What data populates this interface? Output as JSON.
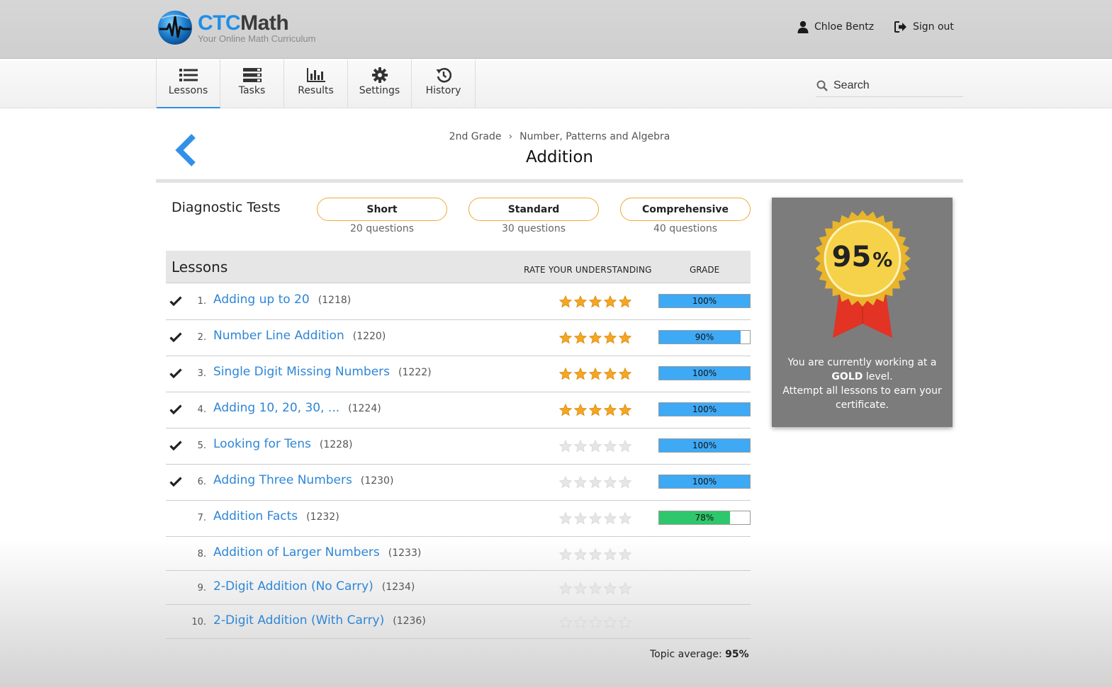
{
  "header": {
    "logo_title_part1": "CTC",
    "logo_title_part2": "Math",
    "logo_subtitle": "Your Online Math Curriculum",
    "user_name": "Chloe Bentz",
    "signout_label": "Sign out"
  },
  "nav": {
    "tabs": [
      {
        "label": "Lessons",
        "icon": "list-icon",
        "active": true
      },
      {
        "label": "Tasks",
        "icon": "tasks-icon",
        "active": false
      },
      {
        "label": "Results",
        "icon": "bar-chart-icon",
        "active": false
      },
      {
        "label": "Settings",
        "icon": "gear-icon",
        "active": false
      },
      {
        "label": "History",
        "icon": "history-icon",
        "active": false
      }
    ],
    "search_placeholder": "Search"
  },
  "breadcrumb": {
    "grade": "2nd Grade",
    "separator": "›",
    "strand": "Number, Patterns and Algebra"
  },
  "page_title": "Addition",
  "diagnostic": {
    "title": "Diagnostic Tests",
    "tests": [
      {
        "label": "Short",
        "sub": "20 questions"
      },
      {
        "label": "Standard",
        "sub": "30 questions"
      },
      {
        "label": "Comprehensive",
        "sub": "40 questions"
      }
    ]
  },
  "lessons": {
    "title": "Lessons",
    "rate_header": "RATE YOUR UNDERSTANDING",
    "grade_header": "GRADE",
    "rows": [
      {
        "num": "1.",
        "name": "Adding up to 20",
        "code": "(1218)",
        "completed": true,
        "rating": 5,
        "grade": 100,
        "grade_text": "100%",
        "bar_color": "#3ea9f5"
      },
      {
        "num": "2.",
        "name": "Number Line Addition",
        "code": "(1220)",
        "completed": true,
        "rating": 5,
        "grade": 90,
        "grade_text": "90%",
        "bar_color": "#3ea9f5"
      },
      {
        "num": "3.",
        "name": "Single Digit Missing Numbers",
        "code": "(1222)",
        "completed": true,
        "rating": 5,
        "grade": 100,
        "grade_text": "100%",
        "bar_color": "#3ea9f5"
      },
      {
        "num": "4.",
        "name": "Adding 10, 20, 30, ...",
        "code": "(1224)",
        "completed": true,
        "rating": 5,
        "grade": 100,
        "grade_text": "100%",
        "bar_color": "#3ea9f5"
      },
      {
        "num": "5.",
        "name": "Looking for Tens",
        "code": "(1228)",
        "completed": true,
        "rating": 0,
        "grade": 100,
        "grade_text": "100%",
        "bar_color": "#3ea9f5"
      },
      {
        "num": "6.",
        "name": "Adding Three Numbers",
        "code": "(1230)",
        "completed": true,
        "rating": 0,
        "grade": 100,
        "grade_text": "100%",
        "bar_color": "#3ea9f5"
      },
      {
        "num": "7.",
        "name": "Addition Facts",
        "code": "(1232)",
        "completed": false,
        "rating": 0,
        "grade": 78,
        "grade_text": "78%",
        "bar_color": "#2ec76b"
      },
      {
        "num": "8.",
        "name": "Addition of Larger Numbers",
        "code": "(1233)",
        "completed": false,
        "rating": 0,
        "grade": null,
        "grade_text": "",
        "bar_color": ""
      },
      {
        "num": "9.",
        "name": "2-Digit Addition (No Carry)",
        "code": "(1234)",
        "completed": false,
        "rating": 0,
        "grade": null,
        "grade_text": "",
        "bar_color": ""
      },
      {
        "num": "10.",
        "name": "2-Digit Addition (With Carry)",
        "code": "(1236)",
        "completed": false,
        "rating": 0,
        "grade": null,
        "grade_text": "",
        "bar_color": ""
      }
    ]
  },
  "topic_average": {
    "label": "Topic average:",
    "value": "95%"
  },
  "award": {
    "score": "95",
    "percent_sign": "%",
    "text_line1": "You are currently working at a",
    "level": "GOLD",
    "text_line2": "level.",
    "text_line3": "Attempt all lessons to earn your certificate.",
    "gold_color": "#f0c93a",
    "ribbon_color": "#e23325"
  },
  "colors": {
    "accent": "#2f8fde",
    "link": "#2e86d6",
    "star_filled": "#f5a623",
    "star_empty": "#e6e6e6",
    "button_border": "#f0a93c"
  }
}
